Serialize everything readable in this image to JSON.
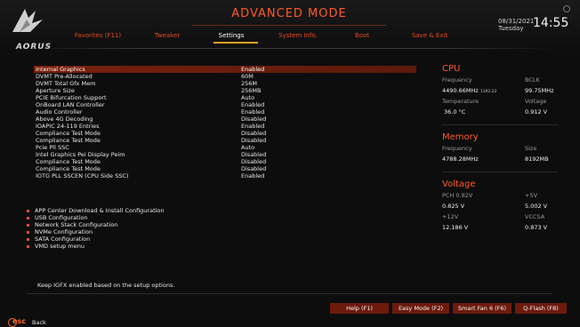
{
  "header": {
    "mode_title": "ADVANCED MODE",
    "logo_text": "AORUS",
    "date": "08/31/2021",
    "day": "Tuesday",
    "time": "14:55"
  },
  "tabs": [
    {
      "label": "Favorites (F11)",
      "active": false
    },
    {
      "label": "Tweaker",
      "active": false
    },
    {
      "label": "Settings",
      "active": true
    },
    {
      "label": "System Info.",
      "active": false
    },
    {
      "label": "Boot",
      "active": false
    },
    {
      "label": "Save & Exit",
      "active": false
    }
  ],
  "settings": [
    {
      "label": "Internal Graphics",
      "value": "Enabled"
    },
    {
      "label": "DVMT Pre-Allocated",
      "value": "60M"
    },
    {
      "label": "DVMT Total Gfx Mem",
      "value": "256M"
    },
    {
      "label": "Aperture Size",
      "value": "256MB"
    },
    {
      "label": "PCIE Bifurcation Support",
      "value": "Auto"
    },
    {
      "label": "OnBoard LAN Controller",
      "value": "Enabled"
    },
    {
      "label": "Audio Controller",
      "value": "Enabled"
    },
    {
      "label": "Above 4G Decoding",
      "value": "Disabled"
    },
    {
      "label": "IOAPIC 24-119 Entries",
      "value": "Enabled"
    },
    {
      "label": "Compliance Test Mode",
      "value": "Disabled"
    },
    {
      "label": "Compliance Test Mode",
      "value": "Disabled"
    },
    {
      "label": "Pcie Pll SSC",
      "value": "Auto"
    },
    {
      "label": "Intel Graphics Pei Display Peim",
      "value": "Disabled"
    },
    {
      "label": "Compliance Test Mode",
      "value": "Disabled"
    },
    {
      "label": "Compliance Test Mode",
      "value": "Disabled"
    },
    {
      "label": "IOTG PLL SSCEN (CPU Side SSC)",
      "value": "Enabled"
    }
  ],
  "submenus": [
    "APP Center Download & Install Configuration",
    "USB Configuration",
    "Network Stack Configuration",
    "NVMe Configuration",
    "SATA Configuration",
    "VMD setup menu"
  ],
  "cpu": {
    "title": "CPU",
    "freq_label": "Frequency",
    "bclk_label": "BCLK",
    "freq_value": "4490.66MHz",
    "freq_small": "1392.22",
    "bclk_value": "99.75MHz",
    "temp_label": "Temperature",
    "volt_label": "Voltage",
    "temp_value": "36.0 °C",
    "volt_value": "0.912 V"
  },
  "memory": {
    "title": "Memory",
    "freq_label": "Frequency",
    "size_label": "Size",
    "freq_value": "4788.28MHz",
    "size_value": "8192MB"
  },
  "voltage": {
    "title": "Voltage",
    "pch_label": "PCH 0.82V",
    "p5_label": "+5V",
    "pch_value": "0.825 V",
    "p5_value": "5.002 V",
    "p12_label": "+12V",
    "vccsa_label": "VCCSA",
    "p12_value": "12.186 V",
    "vccsa_value": "0.873 V"
  },
  "help_text": "Keep IGFX enabled based on the setup options.",
  "footer_buttons": [
    "Help (F1)",
    "Easy Mode (F2)",
    "Smart Fan 6 (F6)",
    "Q-Flash (F8)"
  ],
  "esc": {
    "key": "esc",
    "label": "Back"
  },
  "colors": {
    "accent": "#ff5a2a",
    "highlight": "#7a1f0c",
    "button": "#6d1a0d"
  }
}
